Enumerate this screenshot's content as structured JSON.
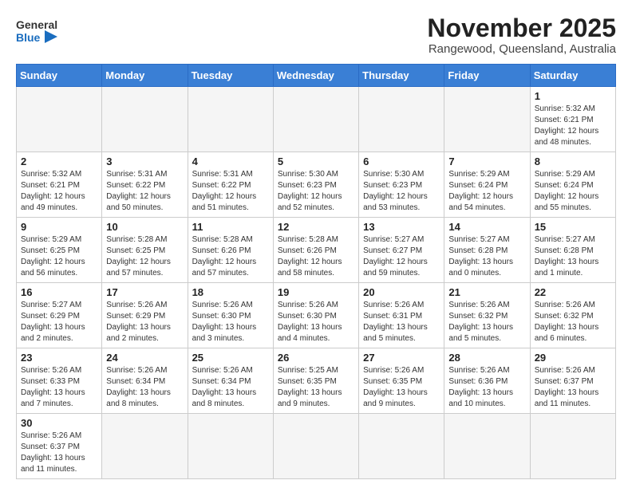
{
  "logo": {
    "line1": "General",
    "line2": "Blue"
  },
  "title": "November 2025",
  "subtitle": "Rangewood, Queensland, Australia",
  "weekdays": [
    "Sunday",
    "Monday",
    "Tuesday",
    "Wednesday",
    "Thursday",
    "Friday",
    "Saturday"
  ],
  "weeks": [
    [
      {
        "day": "",
        "info": ""
      },
      {
        "day": "",
        "info": ""
      },
      {
        "day": "",
        "info": ""
      },
      {
        "day": "",
        "info": ""
      },
      {
        "day": "",
        "info": ""
      },
      {
        "day": "",
        "info": ""
      },
      {
        "day": "1",
        "info": "Sunrise: 5:32 AM\nSunset: 6:21 PM\nDaylight: 12 hours\nand 48 minutes."
      }
    ],
    [
      {
        "day": "2",
        "info": "Sunrise: 5:32 AM\nSunset: 6:21 PM\nDaylight: 12 hours\nand 49 minutes."
      },
      {
        "day": "3",
        "info": "Sunrise: 5:31 AM\nSunset: 6:22 PM\nDaylight: 12 hours\nand 50 minutes."
      },
      {
        "day": "4",
        "info": "Sunrise: 5:31 AM\nSunset: 6:22 PM\nDaylight: 12 hours\nand 51 minutes."
      },
      {
        "day": "5",
        "info": "Sunrise: 5:30 AM\nSunset: 6:23 PM\nDaylight: 12 hours\nand 52 minutes."
      },
      {
        "day": "6",
        "info": "Sunrise: 5:30 AM\nSunset: 6:23 PM\nDaylight: 12 hours\nand 53 minutes."
      },
      {
        "day": "7",
        "info": "Sunrise: 5:29 AM\nSunset: 6:24 PM\nDaylight: 12 hours\nand 54 minutes."
      },
      {
        "day": "8",
        "info": "Sunrise: 5:29 AM\nSunset: 6:24 PM\nDaylight: 12 hours\nand 55 minutes."
      }
    ],
    [
      {
        "day": "9",
        "info": "Sunrise: 5:29 AM\nSunset: 6:25 PM\nDaylight: 12 hours\nand 56 minutes."
      },
      {
        "day": "10",
        "info": "Sunrise: 5:28 AM\nSunset: 6:25 PM\nDaylight: 12 hours\nand 57 minutes."
      },
      {
        "day": "11",
        "info": "Sunrise: 5:28 AM\nSunset: 6:26 PM\nDaylight: 12 hours\nand 57 minutes."
      },
      {
        "day": "12",
        "info": "Sunrise: 5:28 AM\nSunset: 6:26 PM\nDaylight: 12 hours\nand 58 minutes."
      },
      {
        "day": "13",
        "info": "Sunrise: 5:27 AM\nSunset: 6:27 PM\nDaylight: 12 hours\nand 59 minutes."
      },
      {
        "day": "14",
        "info": "Sunrise: 5:27 AM\nSunset: 6:28 PM\nDaylight: 13 hours\nand 0 minutes."
      },
      {
        "day": "15",
        "info": "Sunrise: 5:27 AM\nSunset: 6:28 PM\nDaylight: 13 hours\nand 1 minute."
      }
    ],
    [
      {
        "day": "16",
        "info": "Sunrise: 5:27 AM\nSunset: 6:29 PM\nDaylight: 13 hours\nand 2 minutes."
      },
      {
        "day": "17",
        "info": "Sunrise: 5:26 AM\nSunset: 6:29 PM\nDaylight: 13 hours\nand 2 minutes."
      },
      {
        "day": "18",
        "info": "Sunrise: 5:26 AM\nSunset: 6:30 PM\nDaylight: 13 hours\nand 3 minutes."
      },
      {
        "day": "19",
        "info": "Sunrise: 5:26 AM\nSunset: 6:30 PM\nDaylight: 13 hours\nand 4 minutes."
      },
      {
        "day": "20",
        "info": "Sunrise: 5:26 AM\nSunset: 6:31 PM\nDaylight: 13 hours\nand 5 minutes."
      },
      {
        "day": "21",
        "info": "Sunrise: 5:26 AM\nSunset: 6:32 PM\nDaylight: 13 hours\nand 5 minutes."
      },
      {
        "day": "22",
        "info": "Sunrise: 5:26 AM\nSunset: 6:32 PM\nDaylight: 13 hours\nand 6 minutes."
      }
    ],
    [
      {
        "day": "23",
        "info": "Sunrise: 5:26 AM\nSunset: 6:33 PM\nDaylight: 13 hours\nand 7 minutes."
      },
      {
        "day": "24",
        "info": "Sunrise: 5:26 AM\nSunset: 6:34 PM\nDaylight: 13 hours\nand 8 minutes."
      },
      {
        "day": "25",
        "info": "Sunrise: 5:26 AM\nSunset: 6:34 PM\nDaylight: 13 hours\nand 8 minutes."
      },
      {
        "day": "26",
        "info": "Sunrise: 5:25 AM\nSunset: 6:35 PM\nDaylight: 13 hours\nand 9 minutes."
      },
      {
        "day": "27",
        "info": "Sunrise: 5:26 AM\nSunset: 6:35 PM\nDaylight: 13 hours\nand 9 minutes."
      },
      {
        "day": "28",
        "info": "Sunrise: 5:26 AM\nSunset: 6:36 PM\nDaylight: 13 hours\nand 10 minutes."
      },
      {
        "day": "29",
        "info": "Sunrise: 5:26 AM\nSunset: 6:37 PM\nDaylight: 13 hours\nand 11 minutes."
      }
    ],
    [
      {
        "day": "30",
        "info": "Sunrise: 5:26 AM\nSunset: 6:37 PM\nDaylight: 13 hours\nand 11 minutes."
      },
      {
        "day": "",
        "info": ""
      },
      {
        "day": "",
        "info": ""
      },
      {
        "day": "",
        "info": ""
      },
      {
        "day": "",
        "info": ""
      },
      {
        "day": "",
        "info": ""
      },
      {
        "day": "",
        "info": ""
      }
    ]
  ]
}
